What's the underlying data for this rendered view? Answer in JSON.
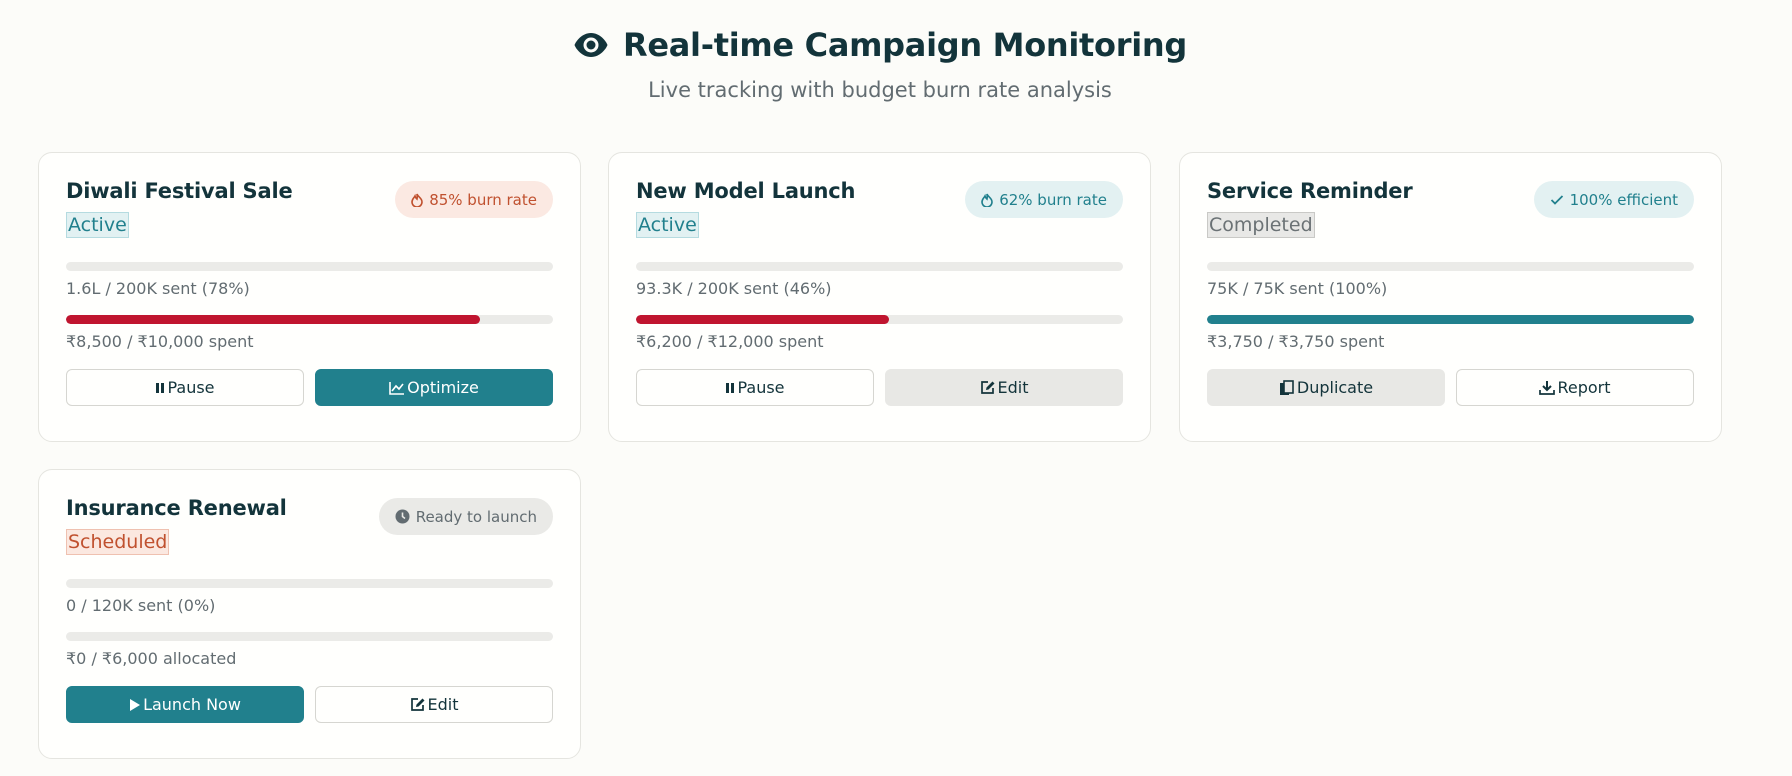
{
  "header": {
    "title": "Real-time Campaign Monitoring",
    "subtitle": "Live tracking with budget burn rate analysis",
    "icon": "eye-icon"
  },
  "colors": {
    "accent": "#21808d",
    "danger": "#c0152f",
    "warning": "#c0512f",
    "text": "#13343b",
    "muted": "#626c71"
  },
  "campaigns": [
    {
      "name": "Diwali Festival Sale",
      "status": "Active",
      "badge": "85% burn rate",
      "badge_icon": "fire-icon",
      "sent_label": "1.6L / 200K sent (78%)",
      "sent_progress": 0,
      "spend_label": "₹8,500 / ₹10,000 spent",
      "spend_progress": 0.85,
      "buttons": [
        {
          "label": "Pause",
          "icon": "pause-icon"
        },
        {
          "label": "Optimize",
          "icon": "chart-line-icon"
        }
      ]
    },
    {
      "name": "New Model Launch",
      "status": "Active",
      "badge": "62% burn rate",
      "badge_icon": "fire-icon",
      "sent_label": "93.3K / 200K sent (46%)",
      "sent_progress": 0,
      "spend_label": "₹6,200 / ₹12,000 spent",
      "spend_progress": 0.52,
      "buttons": [
        {
          "label": "Pause",
          "icon": "pause-icon"
        },
        {
          "label": "Edit",
          "icon": "edit-icon"
        }
      ]
    },
    {
      "name": "Service Reminder",
      "status": "Completed",
      "badge": "100% efficient",
      "badge_icon": "check-icon",
      "sent_label": "75K / 75K sent (100%)",
      "sent_progress": 0,
      "spend_label": "₹3,750 / ₹3,750 spent",
      "spend_progress": 1.0,
      "buttons": [
        {
          "label": "Duplicate",
          "icon": "copy-icon"
        },
        {
          "label": "Report",
          "icon": "download-icon"
        }
      ]
    },
    {
      "name": "Insurance Renewal",
      "status": "Scheduled",
      "badge": "Ready to launch",
      "badge_icon": "clock-icon",
      "sent_label": "0 / 120K sent (0%)",
      "sent_progress": 0,
      "spend_label": "₹0 / ₹6,000 allocated",
      "spend_progress": 0,
      "buttons": [
        {
          "label": "Launch Now",
          "icon": "play-icon"
        },
        {
          "label": "Edit",
          "icon": "edit-icon"
        }
      ]
    }
  ]
}
